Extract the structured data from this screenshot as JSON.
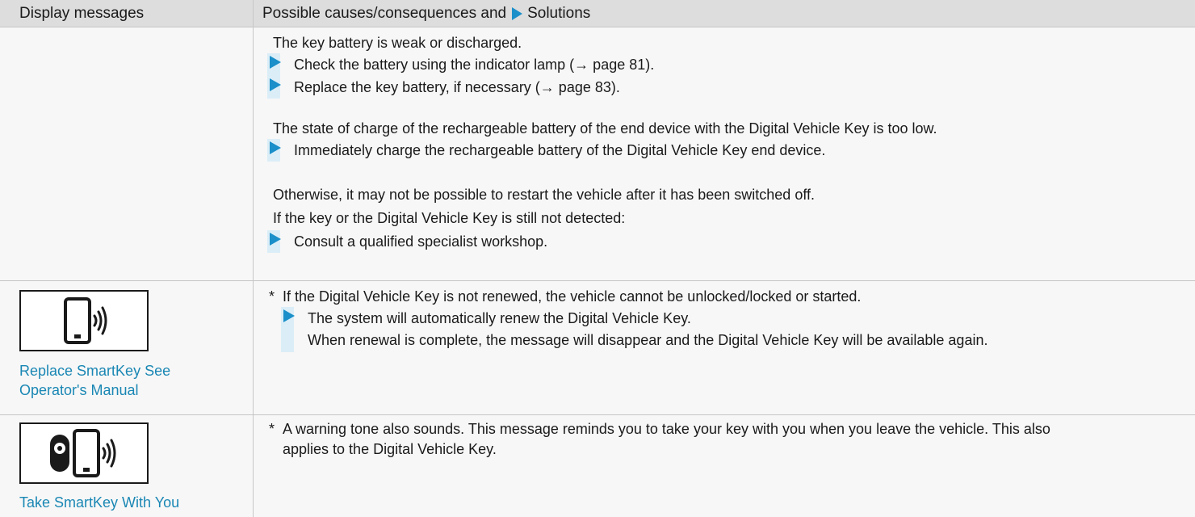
{
  "header": {
    "col1": "Display messages",
    "col2_prefix": "Possible causes/consequences and",
    "col2_suffix": "Solutions"
  },
  "row1": {
    "cause1": "The key battery is weak or discharged.",
    "step1": "Check the battery using the indicator lamp (→ page 81).",
    "step2": "Replace the key battery, if necessary (→ page 83).",
    "cause2": "The state of charge of the rechargeable battery of the end device with the Digital Vehicle Key is too low.",
    "step3": "Immediately charge the rechargeable battery of the Digital Vehicle Key end device.",
    "note1": "Otherwise, it may not be possible to restart the vehicle after it has been switched off.",
    "note2": "If the key or the Digital Vehicle Key is still not detected:",
    "step4": "Consult a qualified specialist workshop."
  },
  "row2": {
    "icon": "phone-signal-icon",
    "label_line1": "Replace SmartKey See",
    "label_line2": "Operator's Manual",
    "bullet": "*",
    "cause": "If the Digital Vehicle Key is not renewed, the vehicle cannot be unlocked/locked or started.",
    "step_line1": "The system will automatically renew the Digital Vehicle Key.",
    "step_line2": "When renewal is complete, the message will disappear and the Digital Vehicle Key will be available again."
  },
  "row3": {
    "icon": "key-and-phone-signal-icon",
    "label": "Take SmartKey With You",
    "bullet": "*",
    "cause_line1": "A warning tone also sounds. This message reminds you to take your key with you when you leave the vehicle. This also",
    "cause_line2": "applies to the Digital Vehicle Key."
  },
  "colors": {
    "accent": "#1a8fc9",
    "link": "#1a87b4",
    "header_bg": "#dddddd",
    "row_bg": "#f7f7f7"
  }
}
